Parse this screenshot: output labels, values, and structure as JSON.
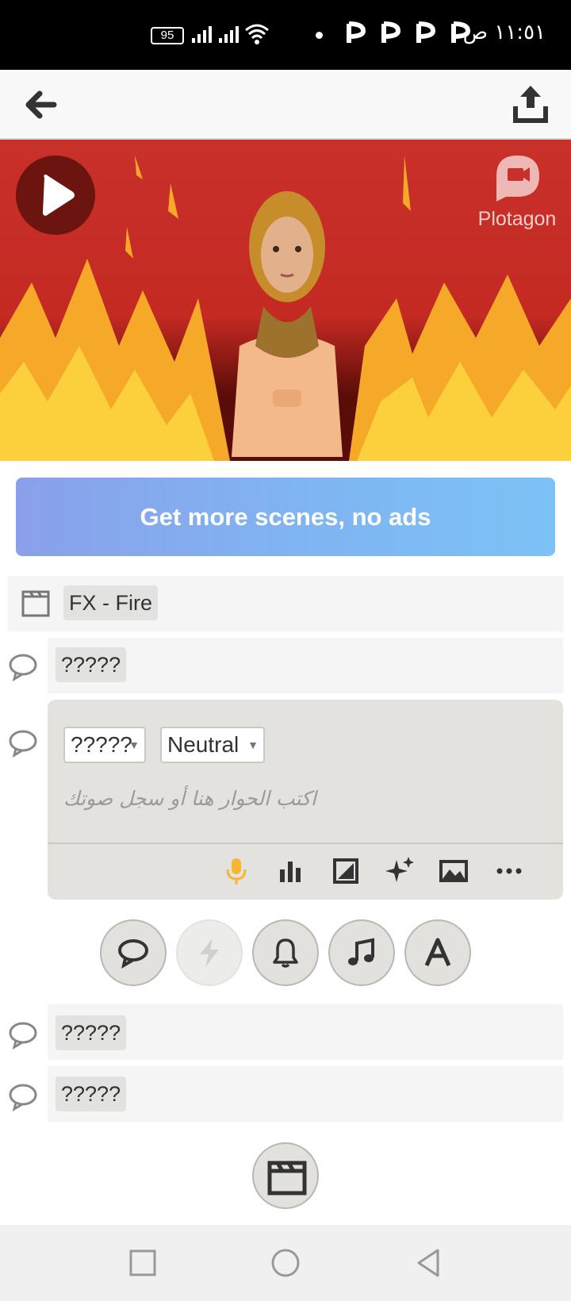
{
  "status_bar": {
    "time": "١١:٥١ ص",
    "battery": "95"
  },
  "app_bar": {
    "back_icon": "back-arrow-icon",
    "share_icon": "share-icon"
  },
  "scene_preview": {
    "brand": "Plotagon",
    "play_icon": "play-icon"
  },
  "promo": {
    "label": "Get more scenes, no ads"
  },
  "scene_row": {
    "label": "FX - Fire"
  },
  "dialogue_lines": [
    {
      "speaker": "?????"
    },
    {
      "speaker": "?????"
    },
    {
      "speaker": "?????"
    }
  ],
  "editor": {
    "character": "?????",
    "mood": "Neutral",
    "placeholder": "اكتب الحوار هنا أو سجل صوتك",
    "tools": [
      "microphone-icon",
      "chart-icon",
      "camera-angle-icon",
      "sparkles-icon",
      "scene-image-icon",
      "more-icon"
    ],
    "mic_color": "#f5b731"
  },
  "add_buttons": [
    "dialogue-icon",
    "action-icon",
    "sound-effect-icon",
    "music-icon",
    "text-icon"
  ],
  "colors": {
    "promo_start": "#8aa0ea",
    "promo_end": "#7cc2f5",
    "fire_red": "#c8302a"
  }
}
